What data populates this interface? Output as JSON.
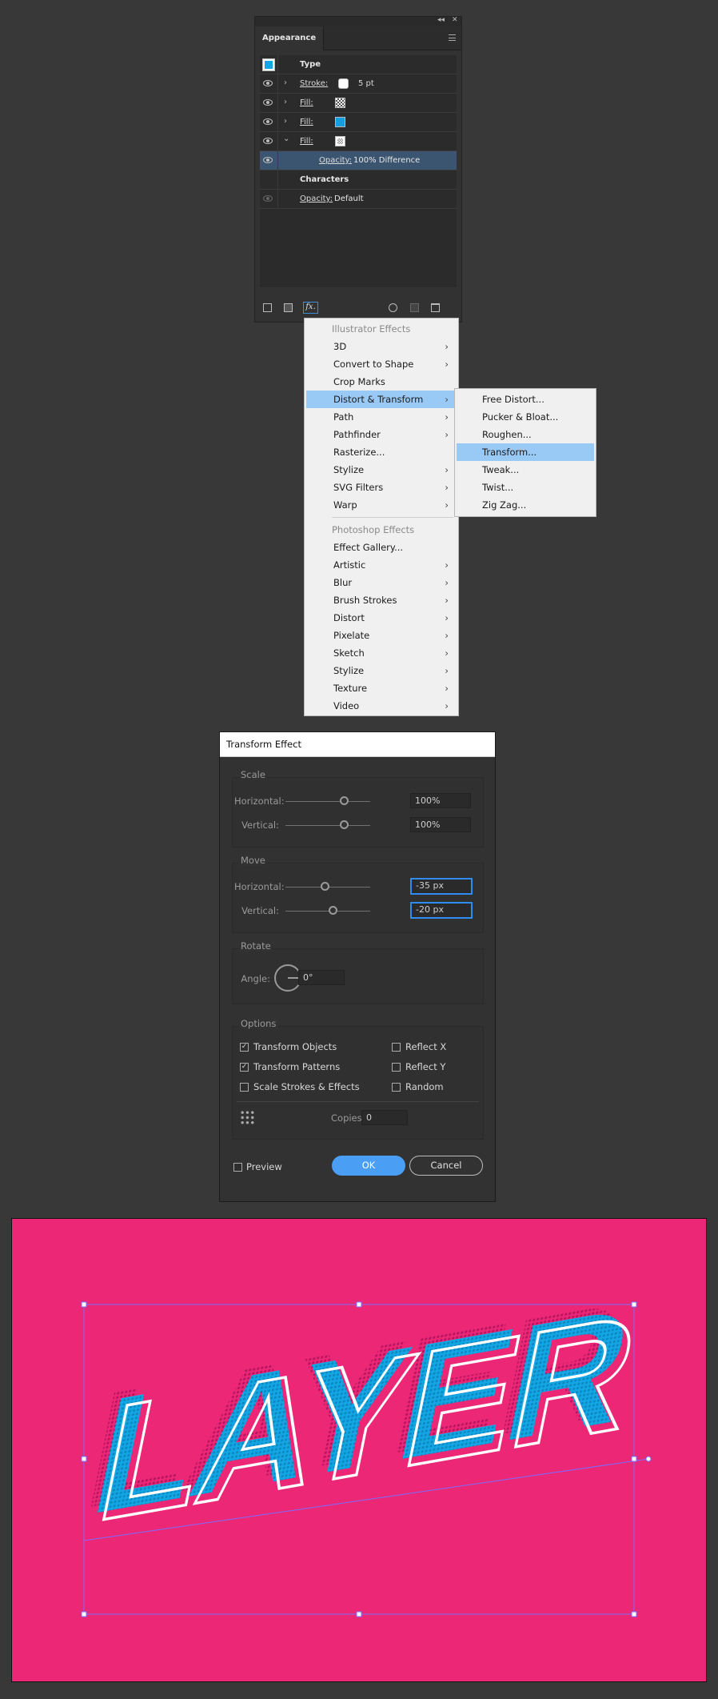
{
  "appearance_panel": {
    "title": "Appearance",
    "object_type": "Type",
    "rows": [
      {
        "label": "Stroke:",
        "value": "5 pt",
        "swatch": "white"
      },
      {
        "label": "Fill:",
        "swatch": "checker"
      },
      {
        "label": "Fill:",
        "swatch": "blue"
      },
      {
        "label": "Fill:",
        "swatch": "pattern",
        "expanded": true
      }
    ],
    "opacity_label": "Opacity:",
    "opacity_value": "100% Difference",
    "characters_label": "Characters",
    "char_opacity_label": "Opacity:",
    "char_opacity_value": "Default",
    "fx_label": "fx."
  },
  "effects_menu": {
    "illustrator_header": "Illustrator Effects",
    "illustrator_items": [
      {
        "label": "3D",
        "submenu": true
      },
      {
        "label": "Convert to Shape",
        "submenu": true
      },
      {
        "label": "Crop Marks",
        "submenu": false
      },
      {
        "label": "Distort & Transform",
        "submenu": true,
        "highlighted": true
      },
      {
        "label": "Path",
        "submenu": true
      },
      {
        "label": "Pathfinder",
        "submenu": true
      },
      {
        "label": "Rasterize...",
        "submenu": false
      },
      {
        "label": "Stylize",
        "submenu": true
      },
      {
        "label": "SVG Filters",
        "submenu": true
      },
      {
        "label": "Warp",
        "submenu": true
      }
    ],
    "photoshop_header": "Photoshop Effects",
    "photoshop_items": [
      {
        "label": "Effect Gallery...",
        "submenu": false
      },
      {
        "label": "Artistic",
        "submenu": true
      },
      {
        "label": "Blur",
        "submenu": true
      },
      {
        "label": "Brush Strokes",
        "submenu": true
      },
      {
        "label": "Distort",
        "submenu": true
      },
      {
        "label": "Pixelate",
        "submenu": true
      },
      {
        "label": "Sketch",
        "submenu": true
      },
      {
        "label": "Stylize",
        "submenu": true
      },
      {
        "label": "Texture",
        "submenu": true
      },
      {
        "label": "Video",
        "submenu": true
      }
    ],
    "submenu_items": [
      {
        "label": "Free Distort..."
      },
      {
        "label": "Pucker & Bloat..."
      },
      {
        "label": "Roughen..."
      },
      {
        "label": "Transform...",
        "highlighted": true
      },
      {
        "label": "Tweak..."
      },
      {
        "label": "Twist..."
      },
      {
        "label": "Zig Zag..."
      }
    ],
    "highlight_color": "#99c9f5"
  },
  "transform_dialog": {
    "title": "Transform Effect",
    "scale": {
      "title": "Scale",
      "h_label": "Horizontal:",
      "h_value": "100%",
      "v_label": "Vertical:",
      "v_value": "100%"
    },
    "move": {
      "title": "Move",
      "h_label": "Horizontal:",
      "h_value": "-35 px",
      "v_label": "Vertical:",
      "v_value": "-20 px"
    },
    "rotate": {
      "title": "Rotate",
      "angle_label": "Angle:",
      "angle_value": "0°"
    },
    "options": {
      "title": "Options",
      "transform_objects": {
        "label": "Transform Objects",
        "checked": true
      },
      "transform_patterns": {
        "label": "Transform Patterns",
        "checked": true
      },
      "scale_strokes": {
        "label": "Scale Strokes & Effects",
        "checked": false
      },
      "reflect_x": {
        "label": "Reflect X",
        "checked": false
      },
      "reflect_y": {
        "label": "Reflect Y",
        "checked": false
      },
      "random": {
        "label": "Random",
        "checked": false
      },
      "copies_label": "Copies",
      "copies_value": "0"
    },
    "preview": {
      "label": "Preview",
      "checked": false
    },
    "ok_label": "OK",
    "cancel_label": "Cancel",
    "accent": "#4a9ff5"
  },
  "artwork": {
    "text": "LAYER",
    "background": "#ec2776",
    "fill_color": "#13a6e4",
    "stroke_color": "#ffffff",
    "selection_color": "#7b6cff"
  }
}
